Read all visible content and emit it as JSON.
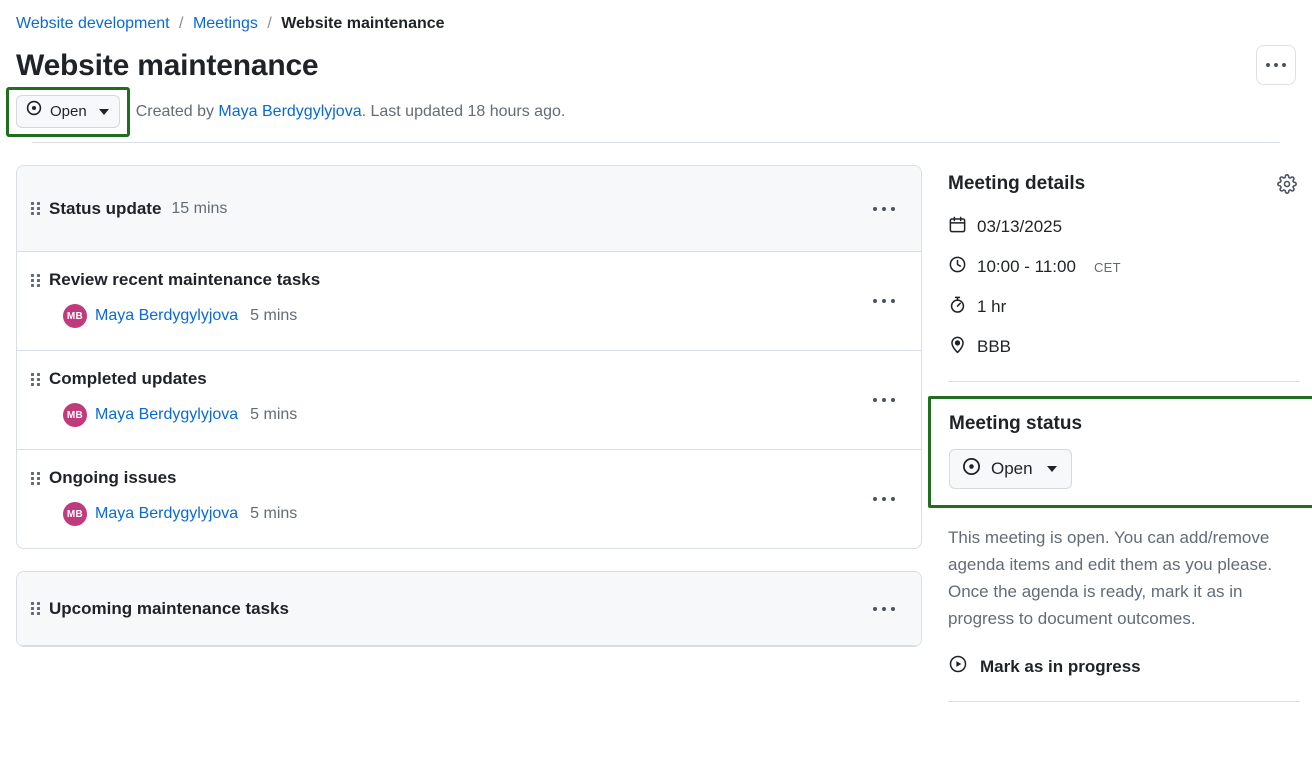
{
  "breadcrumb": {
    "items": [
      {
        "label": "Website development",
        "current": false
      },
      {
        "label": "Meetings",
        "current": false
      },
      {
        "label": "Website maintenance",
        "current": true
      }
    ],
    "separator": "/"
  },
  "header": {
    "title": "Website maintenance",
    "status_label": "Open",
    "status_icon": "issue-open-circle-icon",
    "meta_prefix": "Created by ",
    "meta_author": "Maya Berdygylyjova",
    "meta_suffix": ". Last updated 18 hours ago.",
    "overflow_menu_name": "more-options"
  },
  "agenda": {
    "sections": [
      {
        "title": "Status update",
        "duration": "15 mins",
        "items": [
          {
            "title": "Review recent maintenance tasks",
            "assignee": "Maya Berdygylyjova",
            "assignee_initials": "MB",
            "duration": "5 mins"
          },
          {
            "title": "Completed updates",
            "assignee": "Maya Berdygylyjova",
            "assignee_initials": "MB",
            "duration": "5 mins"
          },
          {
            "title": "Ongoing issues",
            "assignee": "Maya Berdygylyjova",
            "assignee_initials": "MB",
            "duration": "5 mins"
          }
        ]
      },
      {
        "title": "Upcoming maintenance tasks",
        "duration": "",
        "items": []
      }
    ]
  },
  "sidebar": {
    "details_title": "Meeting details",
    "settings_icon": "gear-icon",
    "details": [
      {
        "icon": "calendar-icon",
        "value": "03/13/2025",
        "sub": ""
      },
      {
        "icon": "clock-icon",
        "value": "10:00 - 11:00",
        "sub": "CET"
      },
      {
        "icon": "stopwatch-icon",
        "value": "1 hr",
        "sub": ""
      },
      {
        "icon": "location-pin-icon",
        "value": "BBB",
        "sub": ""
      }
    ],
    "status_title": "Meeting status",
    "status_label": "Open",
    "status_icon": "issue-open-circle-icon",
    "status_description": "This meeting is open. You can add/remove agenda items and edit them as you please. Once the agenda is ready, mark it as in progress to document outcomes.",
    "action_label": "Mark as in progress",
    "action_icon": "play-circle-icon"
  },
  "colors": {
    "link": "#0969da",
    "highlight_ring": "#216e21",
    "avatar": "#bf3b7c",
    "muted_text": "#636c76",
    "card_header_bg": "#f6f8fa",
    "border": "#d8dee4"
  }
}
